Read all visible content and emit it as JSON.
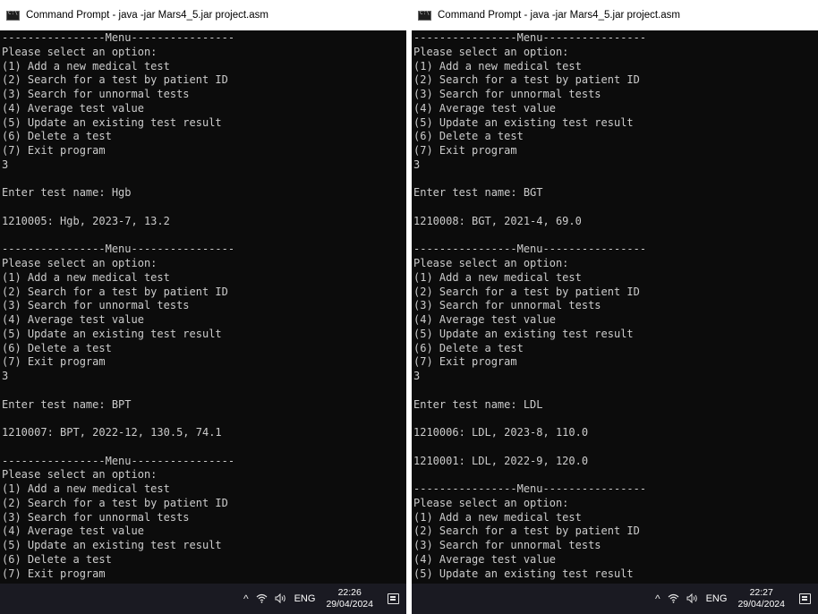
{
  "windows": [
    {
      "title": "Command Prompt - java  -jar Mars4_5.jar project.asm",
      "output": "----------------Menu----------------\nPlease select an option:\n(1) Add a new medical test\n(2) Search for a test by patient ID\n(3) Search for unnormal tests\n(4) Average test value\n(5) Update an existing test result\n(6) Delete a test\n(7) Exit program\n3\n\nEnter test name: Hgb\n\n1210005: Hgb, 2023-7, 13.2\n\n----------------Menu----------------\nPlease select an option:\n(1) Add a new medical test\n(2) Search for a test by patient ID\n(3) Search for unnormal tests\n(4) Average test value\n(5) Update an existing test result\n(6) Delete a test\n(7) Exit program\n3\n\nEnter test name: BPT\n\n1210007: BPT, 2022-12, 130.5, 74.1\n\n----------------Menu----------------\nPlease select an option:\n(1) Add a new medical test\n(2) Search for a test by patient ID\n(3) Search for unnormal tests\n(4) Average test value\n(5) Update an existing test result\n(6) Delete a test\n(7) Exit program",
      "taskbar": {
        "lang": "ENG",
        "time": "22:26",
        "date": "29/04/2024"
      }
    },
    {
      "title": "Command Prompt - java  -jar Mars4_5.jar project.asm",
      "output": "----------------Menu----------------\nPlease select an option:\n(1) Add a new medical test\n(2) Search for a test by patient ID\n(3) Search for unnormal tests\n(4) Average test value\n(5) Update an existing test result\n(6) Delete a test\n(7) Exit program\n3\n\nEnter test name: BGT\n\n1210008: BGT, 2021-4, 69.0\n\n----------------Menu----------------\nPlease select an option:\n(1) Add a new medical test\n(2) Search for a test by patient ID\n(3) Search for unnormal tests\n(4) Average test value\n(5) Update an existing test result\n(6) Delete a test\n(7) Exit program\n3\n\nEnter test name: LDL\n\n1210006: LDL, 2023-8, 110.0\n\n1210001: LDL, 2022-9, 120.0\n\n----------------Menu----------------\nPlease select an option:\n(1) Add a new medical test\n(2) Search for a test by patient ID\n(3) Search for unnormal tests\n(4) Average test value\n(5) Update an existing test result",
      "taskbar": {
        "lang": "ENG",
        "time": "22:27",
        "date": "29/04/2024"
      }
    }
  ],
  "icons": {
    "window_icon": "command-prompt-icon",
    "tray": [
      "chevron-up-icon",
      "wifi-icon",
      "speaker-icon",
      "notification-icon"
    ]
  },
  "colors": {
    "console_bg": "#0c0c0c",
    "console_text": "#cccccc",
    "titlebar_bg": "#ffffff",
    "taskbar_bg": "#1a1a22"
  }
}
